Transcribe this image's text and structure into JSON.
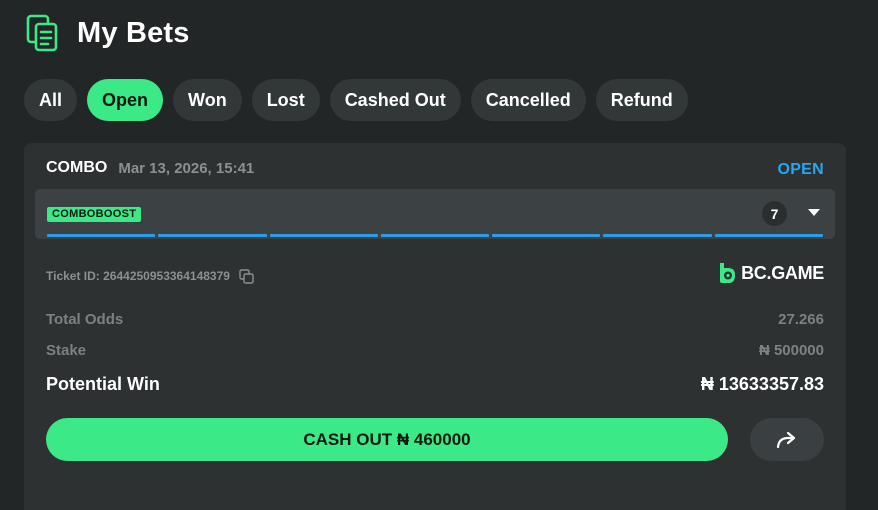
{
  "header": {
    "title": "My Bets",
    "icon": "document-icon",
    "accent": "#3bea86"
  },
  "tabs": [
    {
      "label": "All",
      "active": false
    },
    {
      "label": "Open",
      "active": true
    },
    {
      "label": "Won",
      "active": false
    },
    {
      "label": "Lost",
      "active": false
    },
    {
      "label": "Cashed Out",
      "active": false
    },
    {
      "label": "Cancelled",
      "active": false
    },
    {
      "label": "Refund",
      "active": false
    }
  ],
  "bet": {
    "type": "COMBO",
    "date": "Mar 13, 2026, 15:41",
    "status": "OPEN",
    "status_color": "#29a7ee",
    "boost_badge": "COMBOBOOST",
    "legs_count": "7",
    "progress_color": "#2a9de6",
    "ticket_id": "Ticket ID: 2644250953364148379",
    "brand": "BC.GAME",
    "total_odds_label": "Total Odds",
    "total_odds": "27.266",
    "stake_label": "Stake",
    "stake": "₦ 500000",
    "potential_win_label": "Potential Win",
    "potential_win": "₦ 13633357.83",
    "cashout_label": "CASH OUT ₦ 460000"
  }
}
